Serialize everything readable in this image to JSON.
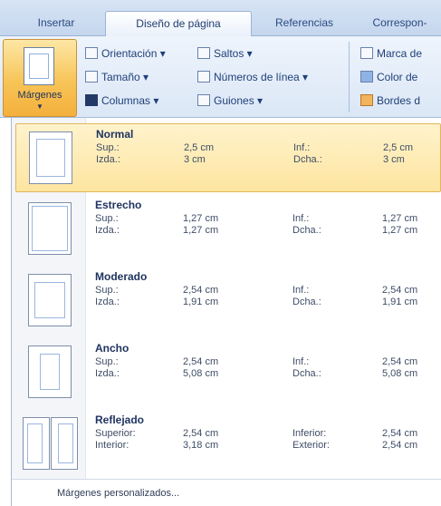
{
  "tabs": [
    {
      "label": "Insertar"
    },
    {
      "label": "Diseño de página"
    },
    {
      "label": "Referencias"
    },
    {
      "label": "Correspon-"
    }
  ],
  "ribbon": {
    "margins_label": "Márgenes",
    "margins_arrow": "▼",
    "items": {
      "orientation": "Orientación ▾",
      "size": "Tamaño ▾",
      "columns": "Columnas ▾",
      "breaks": "Saltos ▾",
      "line_numbers": "Números de línea ▾",
      "hyphenation": "Guiones ▾",
      "watermark": "Marca de",
      "page_color": "Color de",
      "page_borders": "Bordes d"
    }
  },
  "options": [
    {
      "name": "Normal",
      "l1": "Sup.:",
      "v1": "2,5 cm",
      "r1": "Inf.:",
      "w1": "2,5 cm",
      "l2": "Izda.:",
      "v2": "3 cm",
      "r2": "Dcha.:",
      "w2": "3 cm"
    },
    {
      "name": "Estrecho",
      "l1": "Sup.:",
      "v1": "1,27 cm",
      "r1": "Inf.:",
      "w1": "1,27 cm",
      "l2": "Izda.:",
      "v2": "1,27 cm",
      "r2": "Dcha.:",
      "w2": "1,27 cm"
    },
    {
      "name": "Moderado",
      "l1": "Sup.:",
      "v1": "2,54 cm",
      "r1": "Inf.:",
      "w1": "2,54 cm",
      "l2": "Izda.:",
      "v2": "1,91 cm",
      "r2": "Dcha.:",
      "w2": "1,91 cm"
    },
    {
      "name": "Ancho",
      "l1": "Sup.:",
      "v1": "2,54 cm",
      "r1": "Inf.:",
      "w1": "2,54 cm",
      "l2": "Izda.:",
      "v2": "5,08 cm",
      "r2": "Dcha.:",
      "w2": "5,08 cm"
    },
    {
      "name": "Reflejado",
      "l1": "Superior:",
      "v1": "2,54 cm",
      "r1": "Inferior:",
      "w1": "2,54 cm",
      "l2": "Interior:",
      "v2": "3,18 cm",
      "r2": "Exterior:",
      "w2": "2,54 cm"
    }
  ],
  "footer": {
    "custom_label": "Márgenes personalizados..."
  }
}
